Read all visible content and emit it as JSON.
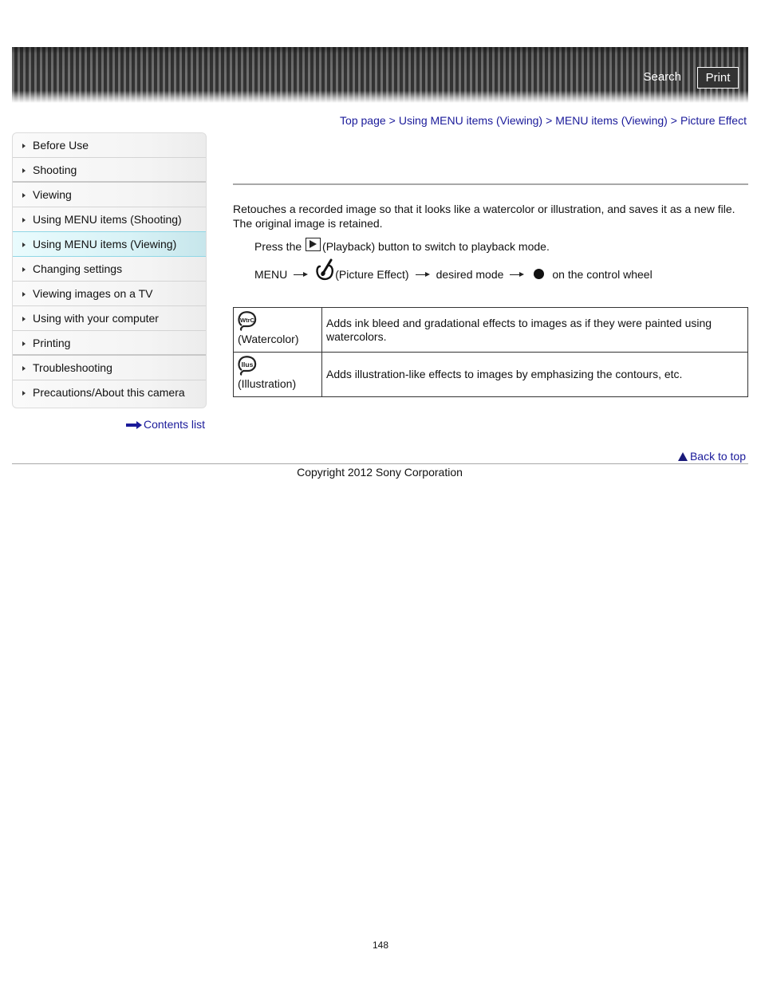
{
  "header": {
    "search_label": "Search",
    "print_label": "Print"
  },
  "breadcrumb": {
    "items": [
      "Top page",
      "Using MENU items (Viewing)",
      "MENU items (Viewing)",
      "Picture Effect"
    ],
    "separator": ">"
  },
  "sidebar": {
    "items": [
      {
        "label": "Before Use"
      },
      {
        "label": "Shooting"
      },
      {
        "label": "Viewing"
      },
      {
        "label": "Using MENU items (Shooting)"
      },
      {
        "label": "Using MENU items (Viewing)",
        "active": true
      },
      {
        "label": "Changing settings"
      },
      {
        "label": "Viewing images on a TV"
      },
      {
        "label": "Using with your computer"
      },
      {
        "label": "Printing"
      },
      {
        "label": "Troubleshooting"
      },
      {
        "label": "Precautions/About this camera"
      }
    ],
    "contents_link": "Contents list"
  },
  "main": {
    "intro": "Retouches a recorded image so that it looks like a watercolor or illustration, and saves it as a new file. The original image is retained.",
    "step1": {
      "before": "Press the",
      "icon": "playback-icon",
      "after": "(Playback) button to switch to playback mode."
    },
    "step2": {
      "menu": "MENU",
      "picture_effect": "(Picture Effect)",
      "desired_mode": "desired mode",
      "control_wheel": "on the control wheel"
    },
    "modes": [
      {
        "icon": "watercolor-icon",
        "icon_text": "WtrC",
        "label": "(Watercolor)",
        "description": "Adds ink bleed and gradational effects to images as if they were painted using watercolors."
      },
      {
        "icon": "illustration-icon",
        "icon_text": "Ilus",
        "label": "(Illustration)",
        "description": "Adds illustration-like effects to images by emphasizing the contours, etc."
      }
    ]
  },
  "footer": {
    "back_to_top": "Back to top",
    "copyright": "Copyright 2012 Sony Corporation",
    "page_number": "148"
  },
  "colors": {
    "link": "#1a1a9a",
    "active_item_bg": "#d8f2f6",
    "active_item_border": "#8fd7e6"
  }
}
